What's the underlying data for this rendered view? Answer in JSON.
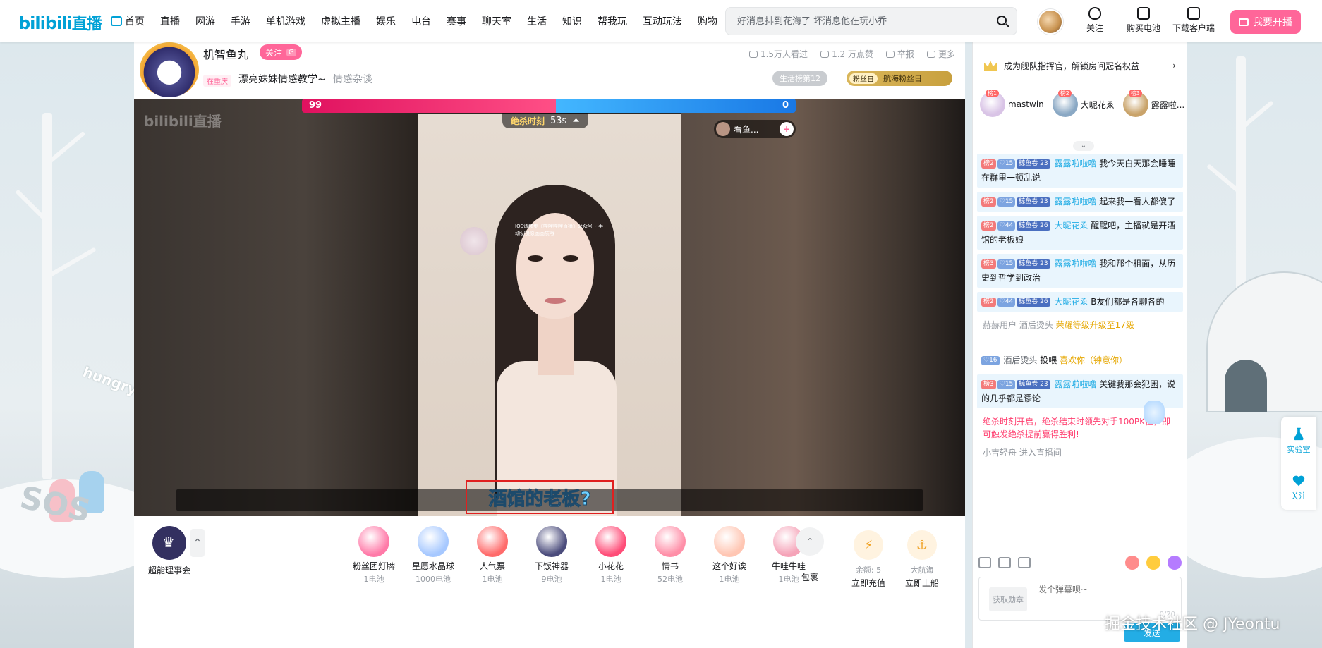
{
  "header": {
    "logo": "bilibili",
    "logo_suffix": "直播",
    "nav": [
      "首页",
      "直播",
      "网游",
      "手游",
      "单机游戏",
      "虚拟主播",
      "娱乐",
      "电台",
      "赛事",
      "聊天室",
      "生活",
      "知识",
      "帮我玩",
      "互动玩法",
      "购物"
    ],
    "search_placeholder": "好消息排到花海了 坏消息他在玩小乔",
    "actions": [
      "关注",
      "购买电池",
      "下载客户端"
    ],
    "live_button": "我要开播"
  },
  "room": {
    "anchor_name": "机智鱼丸",
    "follow_label": "关注",
    "follow_badge": "G",
    "area_tag": "在重庆",
    "title": "漂亮妹妹情感教学~",
    "category": "情感杂谈",
    "stats": {
      "viewers": "1.5万人看过",
      "likes": "1.2 万点赞",
      "report": "举报",
      "more": "更多"
    },
    "rank_badge": "生活榜第12",
    "fan_badge_level": "粉丝日",
    "fan_badge_text": "航海粉丝日"
  },
  "video": {
    "watermark": "bilibili直播",
    "pk": {
      "left_score": "99",
      "right_score": "0",
      "timer_label": "绝杀时刻",
      "timer": "53s",
      "opponent_name": "看鱼..."
    },
    "notice": "IOS请移步《哔哩哔哩直播》公众号~ 手动切换原画画质哦~",
    "subtitle": "酒馆的老板?"
  },
  "gifts": {
    "council_label": "超能理事会",
    "items": [
      {
        "name": "粉丝团灯牌",
        "price": "1电池",
        "color": "#ff7aa8"
      },
      {
        "name": "星愿水晶球",
        "price": "1000电池",
        "color": "#a6c8ff"
      },
      {
        "name": "人气票",
        "price": "1电池",
        "color": "#ff6b6b"
      },
      {
        "name": "下饭神器",
        "price": "9电池",
        "color": "#4b4c7c"
      },
      {
        "name": "小花花",
        "price": "1电池",
        "color": "#ff4d78"
      },
      {
        "name": "情书",
        "price": "52电池",
        "color": "#ff8fa8"
      },
      {
        "name": "这个好诶",
        "price": "1电池",
        "color": "#ffc6b3"
      },
      {
        "name": "牛哇牛哇",
        "price": "1电池",
        "color": "#f5a3b8"
      }
    ],
    "more_label": "包裹",
    "balance_label": "余额: 5",
    "recharge": "立即充值",
    "captain_label": "大航海",
    "board": "立即上船"
  },
  "chat": {
    "guard_banner": "成为舰队指挥官，解锁房间冠名权益",
    "top_users": [
      {
        "rank": "榜1",
        "name": "mastwin",
        "color": "#d9c4e6"
      },
      {
        "rank": "榜2",
        "name": "大昵花ゑ",
        "color": "#8aa8c4"
      },
      {
        "rank": "榜3",
        "name": "露露啦...",
        "color": "#c9a36a"
      }
    ],
    "messages": [
      {
        "rank": "榜2",
        "fan": "15",
        "guard": "鲸鱼卷",
        "guard_lv": "23",
        "user": "露露啦啦噜",
        "text": "我今天白天那会睡睡在群里一顿乱说"
      },
      {
        "rank": "榜2",
        "fan": "15",
        "guard": "鲸鱼卷",
        "guard_lv": "23",
        "user": "露露啦啦噜",
        "text": "起来我一看人都傻了"
      },
      {
        "rank": "榜2",
        "fan": "44",
        "guard": "鲸鱼卷",
        "guard_lv": "26",
        "user": "大昵花ゑ",
        "text": "醒醒吧，主播就是开酒馆的老板娘"
      },
      {
        "rank": "榜3",
        "fan": "15",
        "guard": "鲸鱼卷",
        "guard_lv": "23",
        "user": "露露啦啦噜",
        "text": "我和那个租面，从历史到哲学到政治"
      },
      {
        "rank": "榜2",
        "fan": "44",
        "guard": "鲸鱼卷",
        "guard_lv": "26",
        "user": "大昵花ゑ",
        "text": "B友们都是各聊各的"
      }
    ],
    "level_up_user": "赫赫用户 酒后烫头",
    "level_up_text": "荣耀等级升级至17级",
    "feed": {
      "fan": "16",
      "user": "酒后烫头",
      "verb": "投喂",
      "gift": "喜欢你（钟意你）"
    },
    "last_message": {
      "rank": "榜3",
      "fan": "15",
      "guard": "鲸鱼卷",
      "guard_lv": "23",
      "user": "露露啦啦噜",
      "text": "关键我那会犯困，说的几乎都是谬论"
    },
    "pk_notice": "绝杀时刻开启，绝杀结束时领先对手100PK值，即可触发绝杀提前赢得胜利!",
    "enter_notice": "小吉轻舟 进入直播间",
    "medal_button": "获取勋章",
    "input_placeholder": "发个弹幕呗~",
    "counter": "0/20",
    "send": "发送"
  },
  "dock": {
    "lab": "实验室",
    "follow": "关注"
  },
  "scene": {
    "sos": "SOS",
    "hungry": "hungry"
  },
  "watermark": "掘金技术社区 @ JYeontu"
}
